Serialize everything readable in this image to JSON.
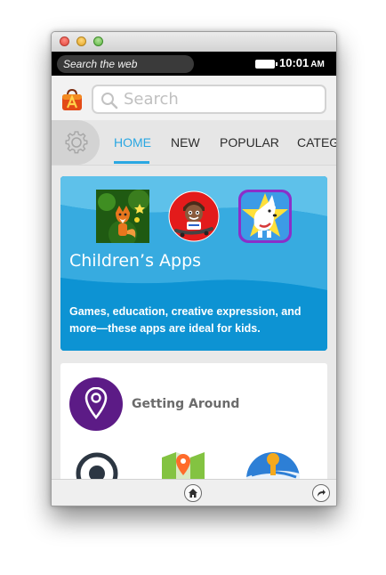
{
  "status_bar": {
    "search_label": "Search the web",
    "time": "10:01",
    "ampm": "AM"
  },
  "search": {
    "placeholder": "Search"
  },
  "tabs": [
    {
      "label": "HOME",
      "active": true
    },
    {
      "label": "NEW",
      "active": false
    },
    {
      "label": "POPULAR",
      "active": false
    },
    {
      "label": "CATEGORIES",
      "active": false
    }
  ],
  "featured": {
    "title": "Children’s Apps",
    "description": "Games, education, creative expression, and more—these apps are ideal for kids."
  },
  "collection": {
    "title": "Getting Around"
  },
  "colors": {
    "accent": "#2aa7e2",
    "banner": "#169ad6",
    "collection_icon": "#5c1b86"
  },
  "icons": {
    "settings": "gear-icon",
    "home": "home-icon",
    "forward": "forward-icon",
    "search": "search-icon",
    "collection": "map-pin-icon"
  }
}
